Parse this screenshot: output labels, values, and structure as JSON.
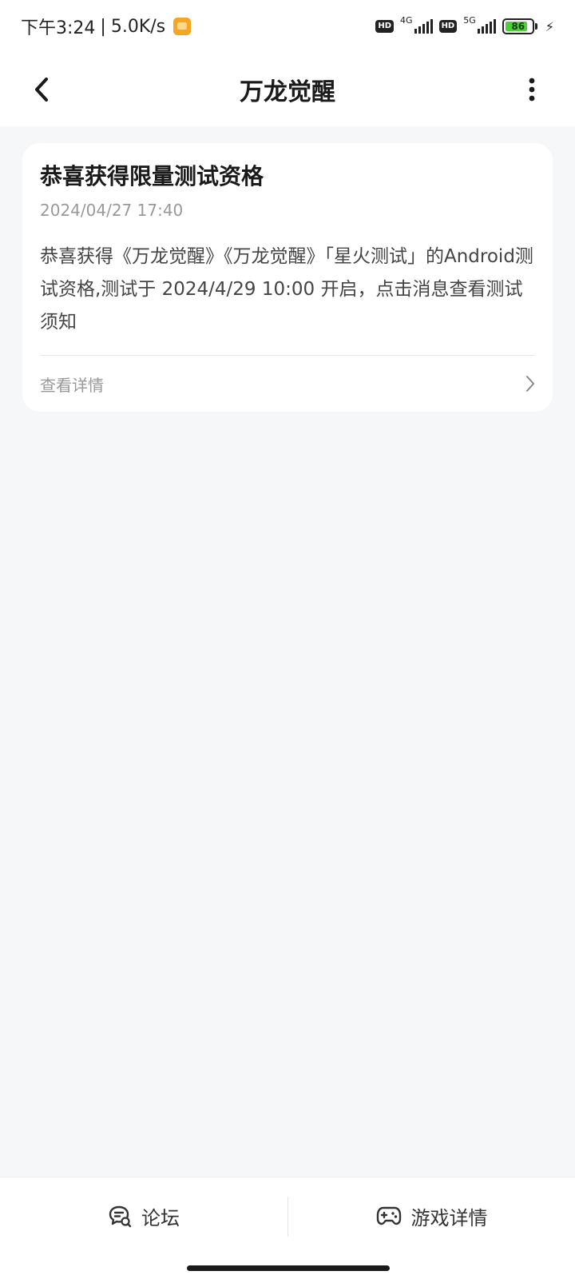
{
  "status_bar": {
    "time": "下午3:24",
    "separator": "|",
    "net_speed": "5.0K/s",
    "hd1": "HD",
    "net1": "4G",
    "hd2": "HD",
    "net2": "5G",
    "battery": "86",
    "battery_level_percent": 86,
    "icons": [
      "notification-app-icon",
      "hd-icon",
      "signal-4g-icon",
      "hd-icon",
      "signal-5g-icon",
      "battery-icon",
      "charging-bolt-icon"
    ]
  },
  "nav": {
    "title": "万龙觉醒",
    "back_icon": "chevron-left-icon",
    "more_icon": "more-vertical-icon"
  },
  "message": {
    "title": "恭喜获得限量测试资格",
    "time": "2024/04/27 17:40",
    "body": "恭喜获得《万龙觉醒》《万龙觉醒》「星火测试」的Android测试资格,测试于 2024/4/29 10:00 开启，点击消息查看测试须知",
    "detail_label": "查看详情"
  },
  "bottom_bar": {
    "forum_label": "论坛",
    "game_label": "游戏详情",
    "forum_icon": "chat-bubble-icon",
    "game_icon": "gamepad-icon"
  },
  "colors": {
    "background": "#f5f7f9",
    "card": "#ffffff",
    "title_text": "#1a1a1a",
    "muted_text": "#999999",
    "battery_fill": "#4cd137"
  }
}
